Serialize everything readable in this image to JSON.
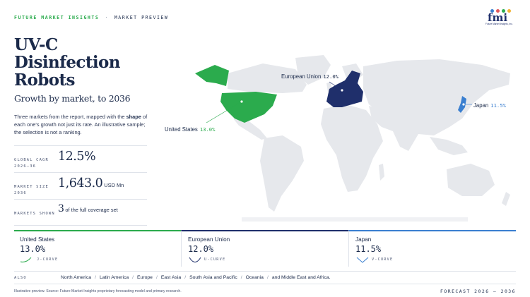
{
  "header": {
    "brand": "FUTURE MARKET INSIGHTS",
    "separator": "·",
    "section": "MARKET PREVIEW"
  },
  "logo": {
    "word": "fmi",
    "tagline": "Future Market Insights, Inc.",
    "dot_colors": [
      "#3a7fd0",
      "#e2575a",
      "#2bab4d",
      "#f2b233"
    ]
  },
  "title": "UV-C Disinfection Robots",
  "subtitle": "Growth by market, to 2036",
  "description": {
    "part1": "Three markets from the report, mapped with the ",
    "bold": "shape",
    "part2": " of each one's growth not just its rate. An illustrative sample; the selection is not a ranking."
  },
  "stats": [
    {
      "label": "GLOBAL CAGR 2026–36",
      "value": "12.5%",
      "unit": ""
    },
    {
      "label": "MARKET SIZE 2036",
      "value": "1,643.0",
      "unit": "USD Mn"
    },
    {
      "label": "MARKETS SHOWN",
      "value": "3",
      "unit": "of the full coverage set"
    }
  ],
  "map": {
    "callouts": [
      {
        "name": "European Union",
        "pct": "12.0%"
      },
      {
        "name": "Japan",
        "pct": "11.5%"
      },
      {
        "name": "United States",
        "pct": "13.0%"
      }
    ],
    "colors": {
      "land": "#e6e8ec",
      "us": "#2bab4d",
      "eu": "#1f2f6b",
      "jp": "#3a7fd0"
    }
  },
  "cards": [
    {
      "name": "United States",
      "value": "13.0%",
      "curve": "J-CURVE",
      "color": "#2bab4d"
    },
    {
      "name": "European Union",
      "value": "12.0%",
      "curve": "U-CURVE",
      "color": "#1f2f6b"
    },
    {
      "name": "Japan",
      "value": "11.5%",
      "curve": "V-CURVE",
      "color": "#3a7fd0"
    }
  ],
  "also": {
    "label": "ALSO",
    "regions": [
      "North America",
      "Latin America",
      "Europe",
      "East Asia",
      "South Asia and Pacific",
      "Oceania",
      "and Middle East and Africa."
    ]
  },
  "footer": {
    "source": "Illustrative preview. Source: Future Market Insights proprietary forecasting model and primary research.",
    "forecast": "FORECAST 2026 – 2036"
  }
}
